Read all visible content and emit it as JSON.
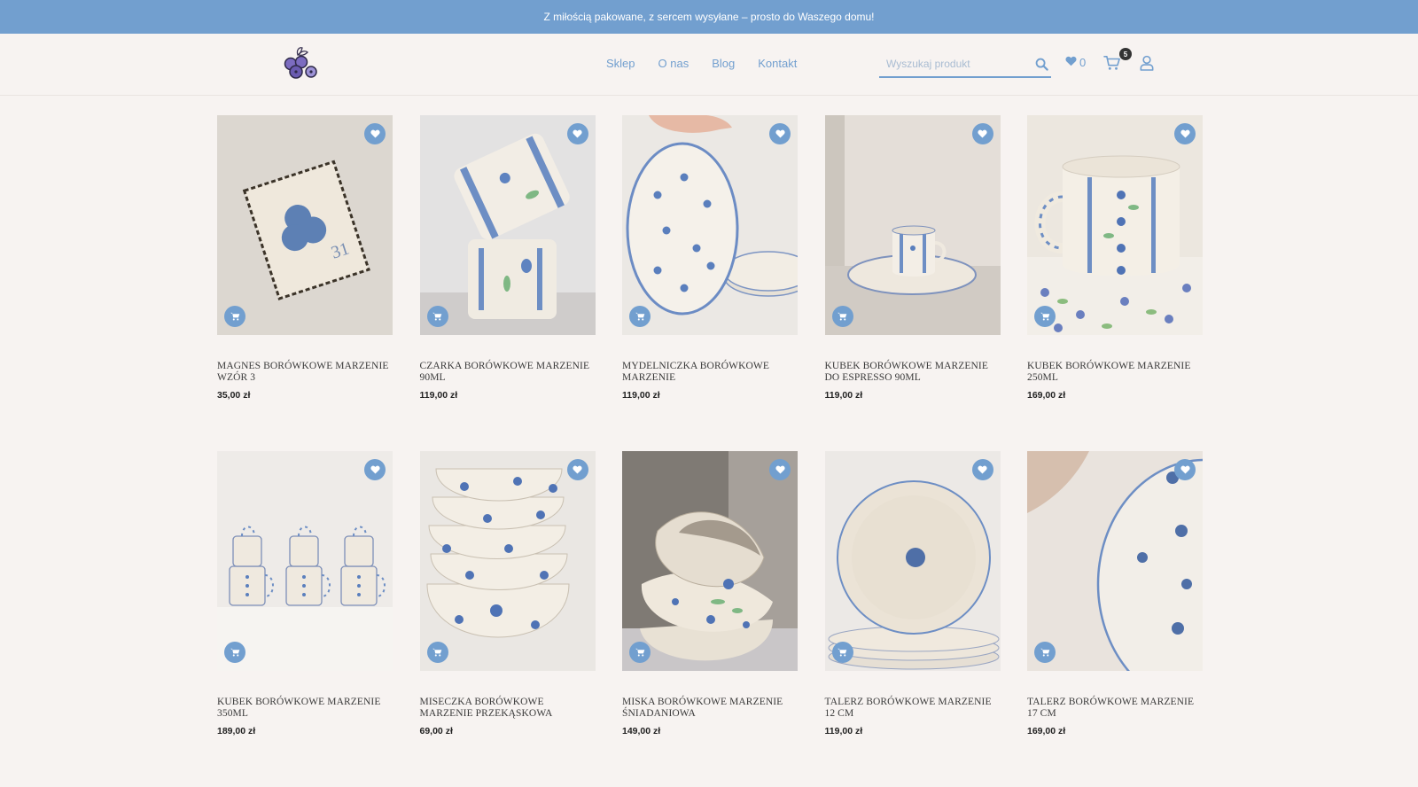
{
  "topbar": {
    "message": "Z miłością pakowane, z sercem wysyłane – prosto do Waszego domu!"
  },
  "header": {
    "nav": [
      {
        "label": "Sklep"
      },
      {
        "label": "O nas"
      },
      {
        "label": "Blog"
      },
      {
        "label": "Kontakt"
      }
    ],
    "search_placeholder": "Wyszukaj produkt",
    "wishlist_count": "0",
    "cart_count": "5"
  },
  "colors": {
    "accent": "#729fcf",
    "background": "#f7f3f1"
  },
  "products": [
    {
      "name": "MAGNES BORÓWKOWE MARZENIE WZÓR 3",
      "price": "35,00 zł"
    },
    {
      "name": "CZARKA BORÓWKOWE MARZENIE 90ML",
      "price": "119,00 zł"
    },
    {
      "name": "MYDELNICZKA BORÓWKOWE MARZENIE",
      "price": "119,00 zł"
    },
    {
      "name": "KUBEK BORÓWKOWE MARZENIE DO ESPRESSO 90ML",
      "price": "119,00 zł"
    },
    {
      "name": "KUBEK BORÓWKOWE MARZENIE 250ML",
      "price": "169,00 zł"
    },
    {
      "name": "KUBEK BORÓWKOWE MARZENIE 350ML",
      "price": "189,00 zł"
    },
    {
      "name": "MISECZKA BORÓWKOWE MARZENIE PRZEKĄSKOWA",
      "price": "69,00 zł"
    },
    {
      "name": "MISKA BORÓWKOWE MARZENIE ŚNIADANIOWA",
      "price": "149,00 zł"
    },
    {
      "name": "TALERZ BORÓWKOWE MARZENIE 12 CM",
      "price": "119,00 zł"
    },
    {
      "name": "TALERZ BORÓWKOWE MARZENIE 17 CM",
      "price": "169,00 zł"
    }
  ]
}
